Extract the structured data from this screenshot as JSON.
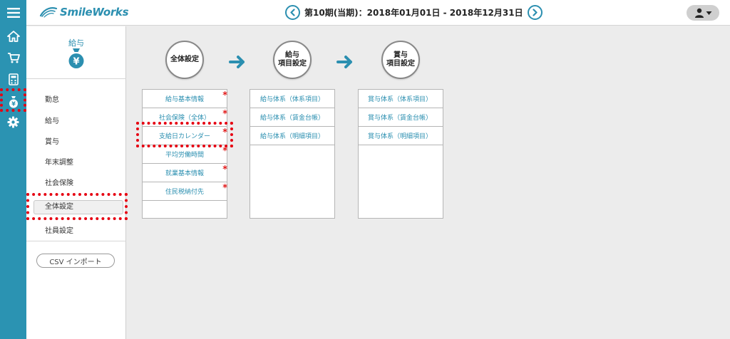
{
  "header": {
    "logo_text": "SmileWorks",
    "period_label": "第10期(当期)：2018年01月01日 - 2018年12月31日"
  },
  "rail": {
    "items": [
      {
        "icon": "hamburger-menu-icon"
      },
      {
        "icon": "home-icon"
      },
      {
        "icon": "cart-icon"
      },
      {
        "icon": "calculator-icon"
      },
      {
        "icon": "money-bag-icon"
      },
      {
        "icon": "gear-icon"
      }
    ]
  },
  "side": {
    "title": "給与",
    "menu": [
      {
        "label": "勤怠"
      },
      {
        "label": "給与"
      },
      {
        "label": "賞与"
      },
      {
        "label": "年末調整"
      },
      {
        "label": "社会保険"
      },
      {
        "label": "全体設定"
      },
      {
        "label": "社員設定"
      }
    ],
    "csv_button": "CSV インポート"
  },
  "flow": {
    "steps": [
      {
        "line1": "全体設定",
        "line2": ""
      },
      {
        "line1": "給与",
        "line2": "項目設定"
      },
      {
        "line1": "賞与",
        "line2": "項目設定"
      }
    ]
  },
  "boxes": {
    "general": [
      {
        "label": "給与基本情報",
        "mark": "*"
      },
      {
        "label": "社会保険（全体）",
        "mark": "*"
      },
      {
        "label": "支給日カレンダー",
        "mark": "*"
      },
      {
        "label": "平均労働時間",
        "mark": "*"
      },
      {
        "label": "就業基本情報",
        "mark": "*"
      },
      {
        "label": "住民税納付先",
        "mark": "*"
      }
    ],
    "salary": [
      {
        "label": "給与体系（体系項目）"
      },
      {
        "label": "給与体系（賃金台帳）"
      },
      {
        "label": "給与体系（明細項目）"
      }
    ],
    "bonus": [
      {
        "label": "賞与体系（体系項目）"
      },
      {
        "label": "賞与体系（賃金台帳）"
      },
      {
        "label": "賞与体系（明細項目）"
      }
    ]
  },
  "colors": {
    "accent": "#2b8fb0",
    "rail": "#2b93b2",
    "highlight": "#e60012",
    "required": "#e21b1b"
  }
}
